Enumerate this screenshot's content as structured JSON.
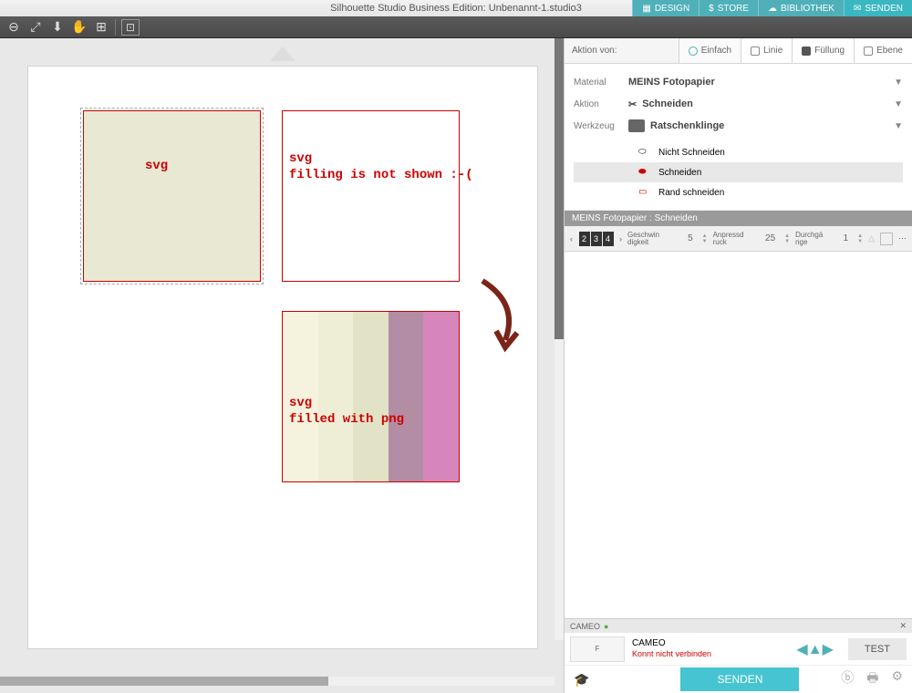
{
  "title": "Silhouette Studio Business Edition: Unbenannt-1.studio3",
  "tabs": {
    "design": "DESIGN",
    "store": "STORE",
    "bibliothek": "BIBLIOTHEK",
    "senden": "SENDEN"
  },
  "aktion_von": "Aktion von:",
  "subtabs": {
    "einfach": "Einfach",
    "linie": "Linie",
    "fullung": "Füllung",
    "ebene": "Ebene"
  },
  "config": {
    "material_lbl": "Material",
    "material_val": "MEINS Fotopapier",
    "aktion_lbl": "Aktion",
    "aktion_val": "Schneiden",
    "werkzeug_lbl": "Werkzeug",
    "werkzeug_val": "Ratschenklinge"
  },
  "cut_opts": {
    "nicht": "Nicht Schneiden",
    "schneiden": "Schneiden",
    "rand": "Rand schneiden"
  },
  "preset": "MEINS Fotopapier : Schneiden",
  "params": {
    "thickness": [
      "2",
      "3",
      "4"
    ],
    "speed_lbl": "Geschwin\ndigkeit",
    "speed_val": "5",
    "force_lbl": "Anpressd\nruck",
    "force_val": "25",
    "passes_lbl": "Durchgä\nnge",
    "passes_val": "1"
  },
  "device": {
    "name": "CAMEO",
    "title": "CAMEO",
    "err": "Konnt nicht verbinden",
    "test": "TEST"
  },
  "send": "SENDEN",
  "canvas": {
    "lbl1": "svg",
    "lbl2": "svg\nfilling is not shown :-(",
    "lbl3": "svg\nfilled with png"
  }
}
